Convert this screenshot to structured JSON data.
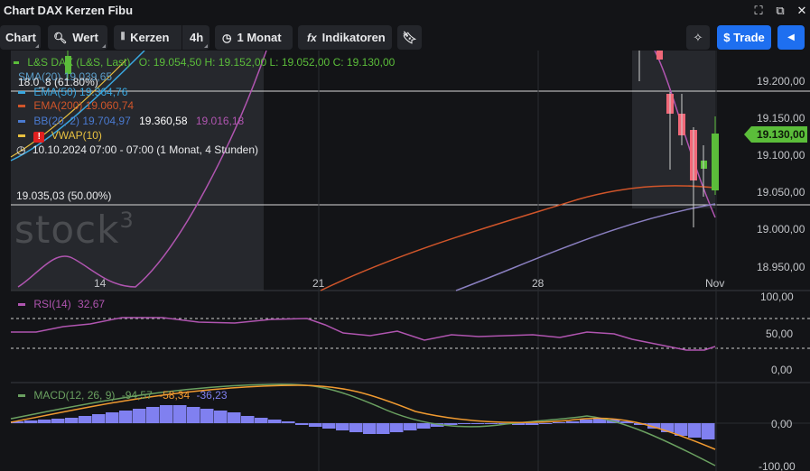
{
  "window": {
    "title": "Chart DAX Kerzen Fibu",
    "controls": [
      "fullscreen-icon",
      "popout-icon",
      "close-icon"
    ]
  },
  "toolbar": {
    "chart_label": "Chart",
    "search_label": "Wert",
    "chart_type_label": "Kerzen",
    "interval_label": "4h",
    "period_label": "1 Monat",
    "indicators_label": "Indikatoren",
    "trade_label": "$ Trade"
  },
  "legend": {
    "instrument": "L&S DAX (L&S, Last)",
    "ohlc": "O: 19.054,50  H: 19.152,00  L: 19.052,00  C: 19.130,00",
    "sma": "SMA(20) 19.039,65",
    "fib": "18.0_8 (61.80%)",
    "ema50": "EMA(50) 19.364,76",
    "ema200": "EMA(200) 19.060,74",
    "bb": "BB(20, 2) 19.704,97",
    "bb_mid": "19.360,58",
    "bb_low": "19.016,18",
    "vwap": "VWAP(10)",
    "date_range": "10.10.2024 07:00 - 07:00  (1 Monat, 4 Stunden)",
    "fib_50": "19.035,03 (50.00%)"
  },
  "colors": {
    "up": "#5bbd3a",
    "down": "#f06878",
    "sma": "#3aa8e0",
    "ema50": "#3aa8e0",
    "ema200": "#d0552a",
    "bb": "#b055b0",
    "vwap": "#e8c040",
    "ema_slow": "#8a7fc0",
    "rsi": "#b055b0",
    "macd_line": "#6aa060",
    "signal": "#f09a30",
    "hist": "#8080f0"
  },
  "price_axis": {
    "ticks": [
      "19.200,00",
      "19.150,00",
      "19.100,00",
      "19.050,00",
      "19.000,00",
      "18.950,00"
    ],
    "current": "19.130,00"
  },
  "time_axis": {
    "ticks": [
      "14",
      "21",
      "28",
      "Nov"
    ]
  },
  "rsi": {
    "label": "RSI(14)",
    "value": "32,67",
    "ticks": [
      "100,00",
      "50,00",
      "0,00"
    ]
  },
  "macd": {
    "label": "MACD(12, 26, 9)",
    "macd_value": "-94,57",
    "signal_value": "-58,34",
    "hist_value": "-36,23",
    "ticks": [
      "0,00",
      "-100,00"
    ]
  },
  "watermark": "stock",
  "watermark_sup": "3"
}
